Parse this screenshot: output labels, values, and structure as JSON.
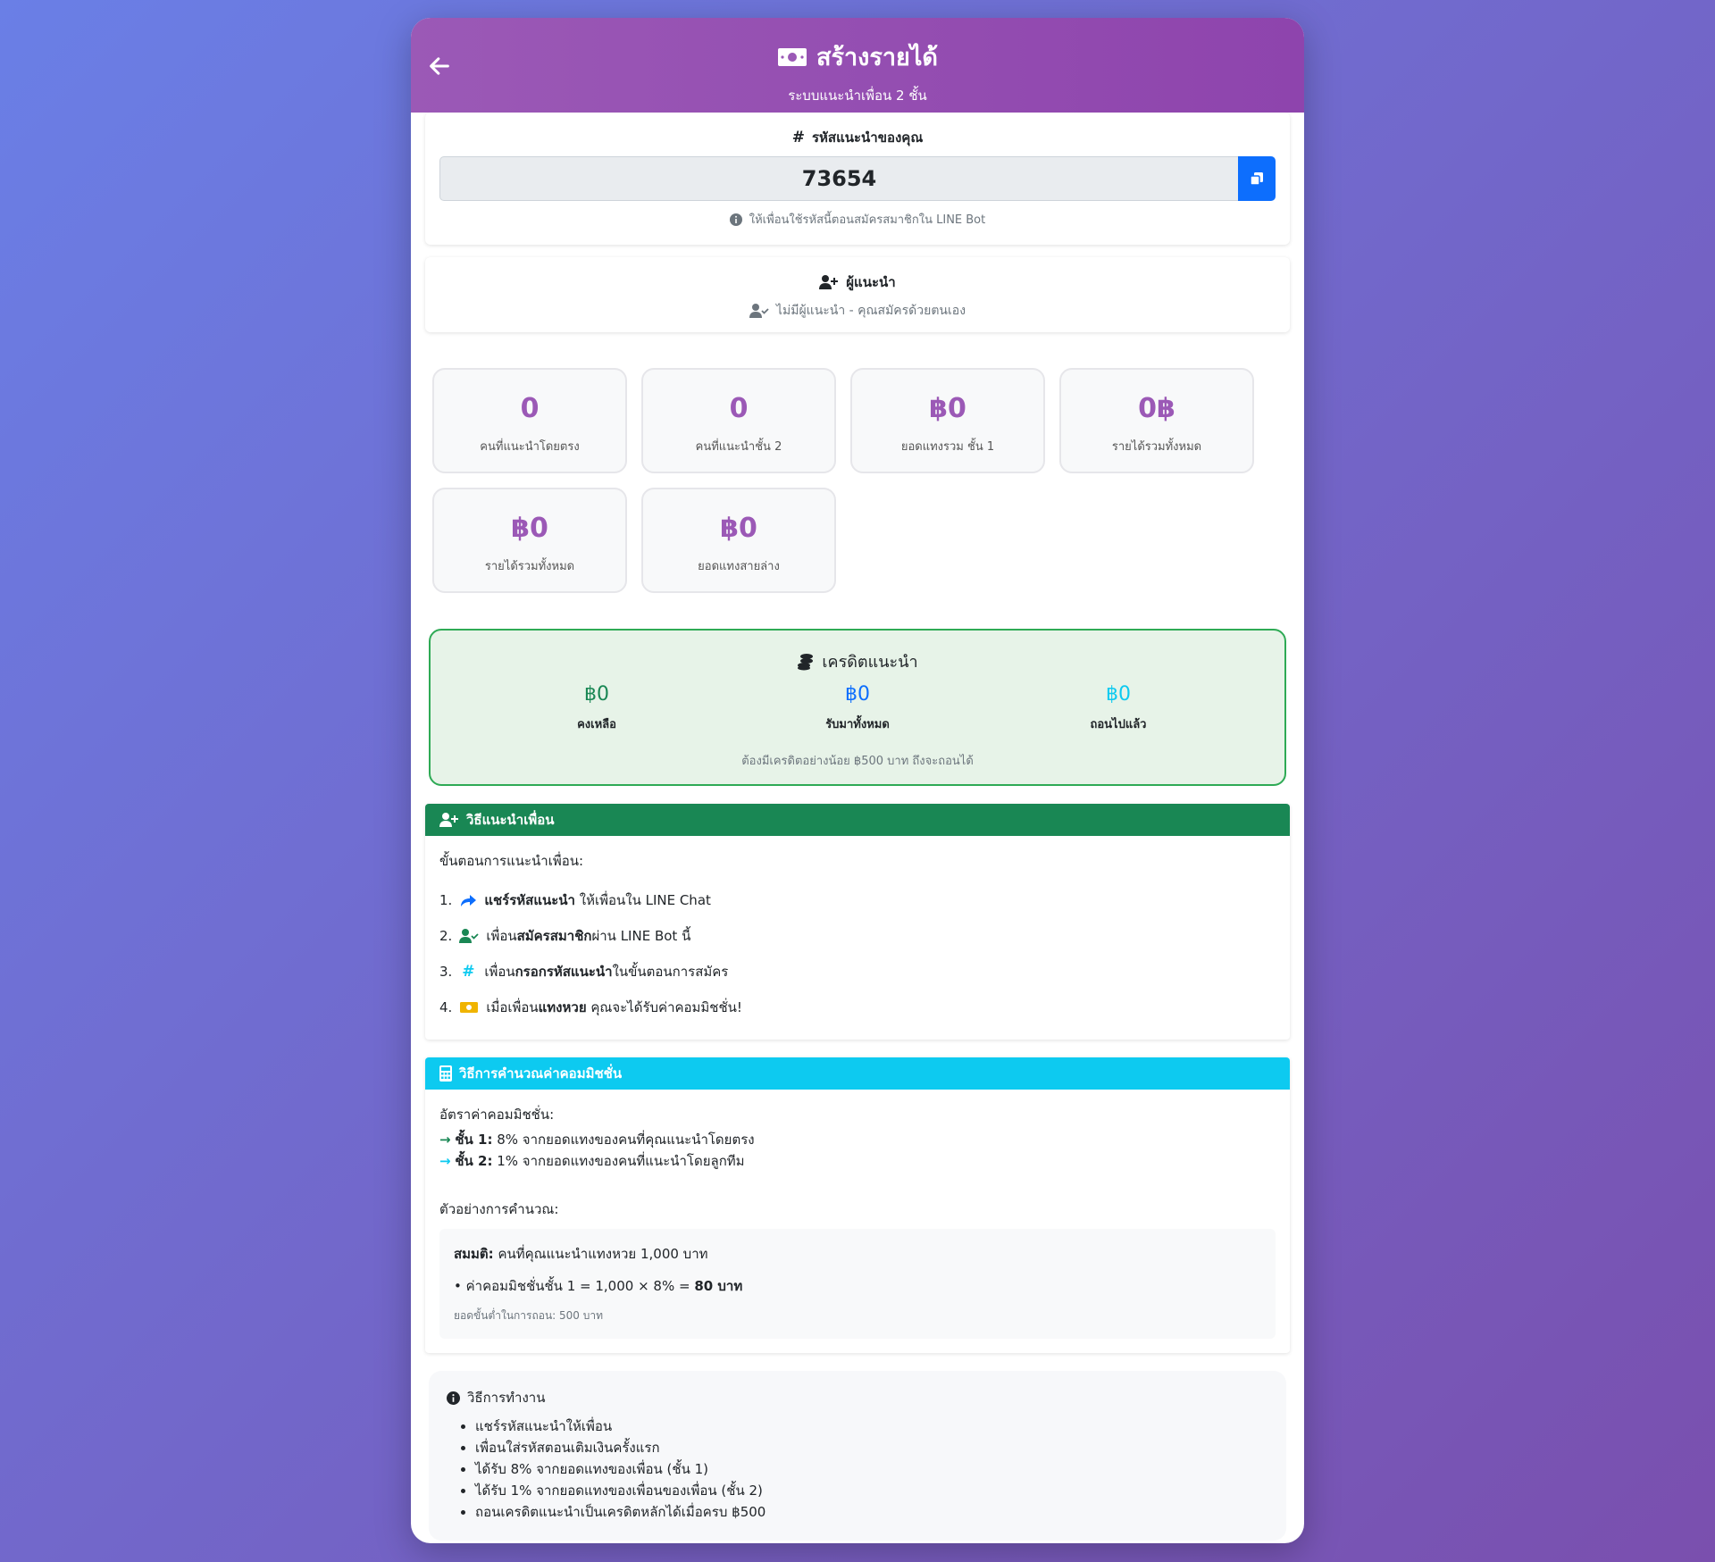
{
  "header": {
    "title": "สร้างรายได้",
    "subtitle": "ระบบแนะนำเพื่อน 2 ชั้น"
  },
  "referral_code": {
    "label": "รหัสแนะนำของคุณ",
    "value": "73654",
    "hint": "ให้เพื่อนใช้รหัสนี้ตอนสมัครสมาชิกใน LINE Bot"
  },
  "referrer": {
    "label": "ผู้แนะนำ",
    "none_text": "ไม่มีผู้แนะนำ - คุณสมัครด้วยตนเอง"
  },
  "stats": [
    {
      "value": "0",
      "label": "คนที่แนะนำโดยตรง"
    },
    {
      "value": "0",
      "label": "คนที่แนะนำชั้น 2"
    },
    {
      "value": "฿0",
      "label": "ยอดแทงรวม ชั้น 1"
    },
    {
      "value": "0฿",
      "label": "รายได้รวมทั้งหมด"
    },
    {
      "value": "฿0",
      "label": "รายได้รวมทั้งหมด"
    },
    {
      "value": "฿0",
      "label": "ยอดแทงสายล่าง"
    }
  ],
  "credit": {
    "title": "เครดิตแนะนำ",
    "balance": {
      "value": "฿0",
      "label": "คงเหลือ"
    },
    "received": {
      "value": "฿0",
      "label": "รับมาทั้งหมด"
    },
    "withdrawn": {
      "value": "฿0",
      "label": "ถอนไปแล้ว"
    },
    "note": "ต้องมีเครดิตอย่างน้อย ฿500 บาท ถึงจะถอนได้",
    "colors": {
      "balance": "#198754",
      "received": "#0d6efd",
      "withdrawn": "#0dcaf0"
    }
  },
  "how_to_refer": {
    "title": "วิธีแนะนำเพื่อน",
    "intro": "ขั้นตอนการแนะนำเพื่อน:",
    "steps": [
      {
        "num": "1.",
        "pre": "",
        "bold": "แชร์รหัสแนะนำ",
        "post": " ให้เพื่อนใน LINE Chat"
      },
      {
        "num": "2.",
        "pre": "เพื่อน",
        "bold": "สมัครสมาชิก",
        "post": "ผ่าน LINE Bot นี้"
      },
      {
        "num": "3.",
        "pre": "เพื่อน",
        "bold": "กรอกรหัสแนะนำ",
        "post": "ในขั้นตอนการสมัคร"
      },
      {
        "num": "4.",
        "pre": "เมื่อเพื่อน",
        "bold": "แทงหวย",
        "post": " คุณจะได้รับค่าคอมมิชชั่น!"
      }
    ]
  },
  "commission": {
    "title": "วิธีการคำนวณค่าคอมมิชชั่น",
    "rates_title": "อัตราค่าคอมมิชชั่น:",
    "rates": [
      {
        "tier": "ชั้น 1:",
        "text": " 8% จากยอดแทงของคนที่คุณแนะนำโดยตรง"
      },
      {
        "tier": "ชั้น 2:",
        "text": " 1% จากยอดแทงของคนที่แนะนำโดยลูกทีม"
      }
    ],
    "example_title": "ตัวอย่างการคำนวณ:",
    "example_assume_label": "สมมติ:",
    "example_assume_text": " คนที่คุณแนะนำแทงหวย 1,000 บาท",
    "example_calc_text": "• ค่าคอมมิชชั่นชั้น 1 = 1,000 × 8% = ",
    "example_calc_result": "80 บาท",
    "example_min": "ยอดขั้นต่ำในการถอน: 500 บาท"
  },
  "how_it_works": {
    "title": "วิธีการทำงาน",
    "items": [
      "แชร์รหัสแนะนำให้เพื่อน",
      "เพื่อนใส่รหัสตอนเติมเงินครั้งแรก",
      "ได้รับ 8% จากยอดแทงของเพื่อน (ชั้น 1)",
      "ได้รับ 1% จากยอดแทงของเพื่อนของเพื่อน (ชั้น 2)",
      "ถอนเครดิตแนะนำเป็นเครดิตหลักได้เมื่อครบ ฿500"
    ]
  }
}
